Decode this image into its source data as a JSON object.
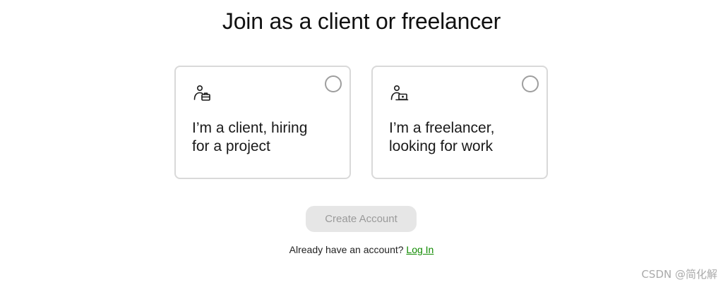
{
  "title": "Join as a client or freelancer",
  "options": [
    {
      "icon": "client-briefcase-icon",
      "line1": "I’m a client, hiring",
      "line2": "for a project",
      "selected": false
    },
    {
      "icon": "freelancer-laptop-icon",
      "line1": "I’m a freelancer,",
      "line2": "looking for work",
      "selected": false
    }
  ],
  "create_account": {
    "label": "Create Account",
    "enabled": false
  },
  "login": {
    "prompt": "Already have an account?",
    "link_label": "Log In",
    "link_color": "#108a00"
  },
  "watermark": "CSDN @简化解"
}
